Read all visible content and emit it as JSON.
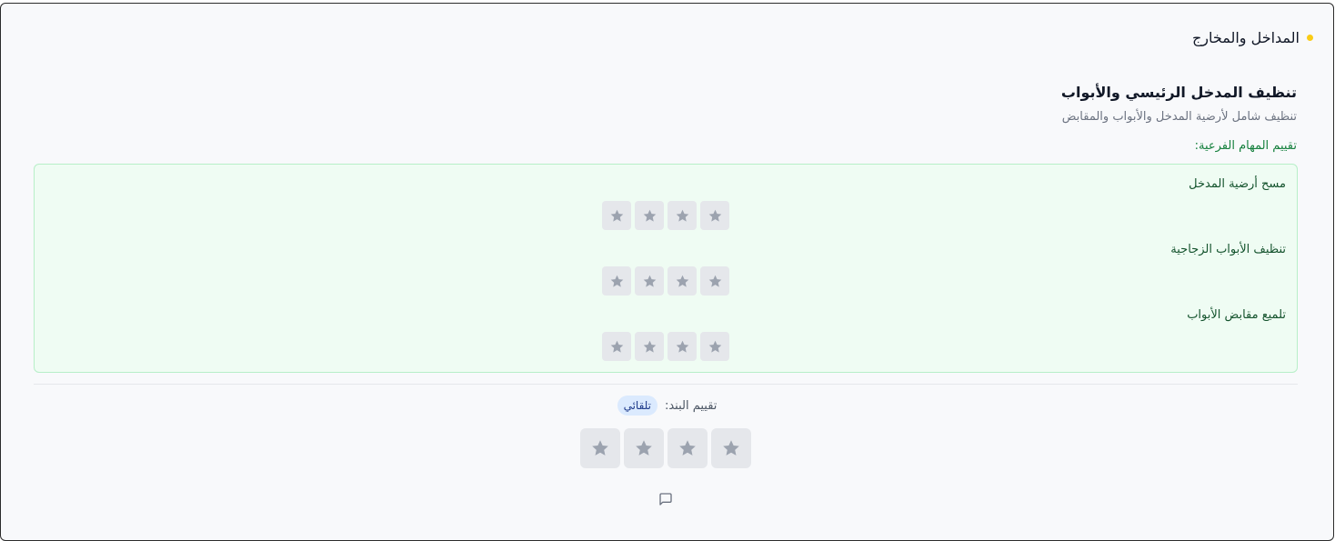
{
  "section": {
    "title": "المداخل والمخارج",
    "dot_color": "#facc15"
  },
  "item": {
    "title": "تنظيف المدخل الرئيسي والأبواب",
    "description": "تنظيف شامل لأرضية المدخل والأبواب والمقابض",
    "subtasks_label": "تقييم المهام الفرعية:",
    "subtasks": [
      {
        "name": "مسح أرضية المدخل",
        "rating": 0,
        "max_rating": 4
      },
      {
        "name": "تنظيف الأبواب الزجاجية",
        "rating": 0,
        "max_rating": 4
      },
      {
        "name": "تلميع مقابض الأبواب",
        "rating": 0,
        "max_rating": 4
      }
    ]
  },
  "overall": {
    "label": "تقييم البند:",
    "badge": "تلقائي",
    "rating": 0,
    "max_rating": 4
  },
  "icons": {
    "star": "star-icon",
    "comment": "comment-icon"
  },
  "colors": {
    "star_fill": "#9ca3af",
    "subtasks_bg": "#effcf3",
    "subtasks_border": "#b7efc8",
    "subtasks_label": "#15803d",
    "badge_bg": "#dbeafe",
    "badge_text": "#1e3a8a"
  }
}
